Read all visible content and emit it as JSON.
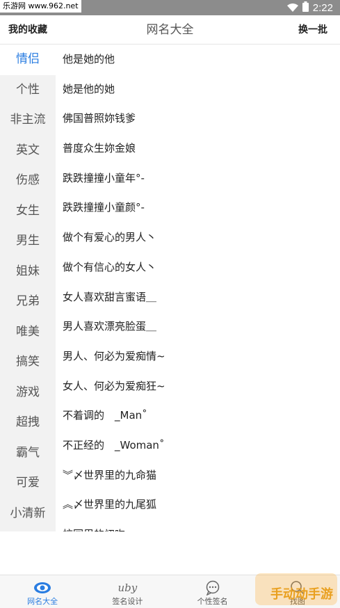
{
  "watermark": {
    "top_left": "乐游网 www.962.net",
    "bottom_right": "手动动手游"
  },
  "status_bar": {
    "time": "2:22"
  },
  "header": {
    "left_label": "我的收藏",
    "title": "网名大全",
    "right_label": "换一批"
  },
  "sidebar": {
    "active_index": 0,
    "items": [
      "情侣",
      "个性",
      "非主流",
      "英文",
      "伤感",
      "女生",
      "男生",
      "姐妹",
      "兄弟",
      "唯美",
      "搞笑",
      "游戏",
      "超拽",
      "霸气",
      "可爱",
      "小清新"
    ]
  },
  "names": [
    "他是她的他",
    "她是他的她",
    "佛国普照妳钱爹",
    "普度众生妳金娘",
    "跌跌撞撞小童年°-",
    "跌跌撞撞小童颜°-",
    "做个有爱心的男人丶",
    "做个有信心的女人丶",
    "女人喜欢甜言蜜语＿",
    "男人喜欢漂亮脸蛋＿",
    "男人、何必为爱痴情~",
    "女人、何必为爱痴狂~",
    "不着调的　_̲Man˚",
    "不正经的　_̲Woman˚",
    "︾〆世界里的九命猫",
    "︽〆世界里的九尾狐",
    "校园里的初吻、"
  ],
  "tabbar": {
    "active_index": 0,
    "items": [
      {
        "label": "网名大全",
        "icon": "eye-icon"
      },
      {
        "label": "签名设计",
        "icon": "signature-script-icon",
        "glyph": "uby"
      },
      {
        "label": "个性签名",
        "icon": "chat-bubble-icon"
      },
      {
        "label": "找图",
        "icon": "search-icon"
      }
    ]
  },
  "colors": {
    "accent": "#2a7de1",
    "sidebar_bg": "#f2f2f2",
    "status_bar": "#8c8c8c"
  }
}
